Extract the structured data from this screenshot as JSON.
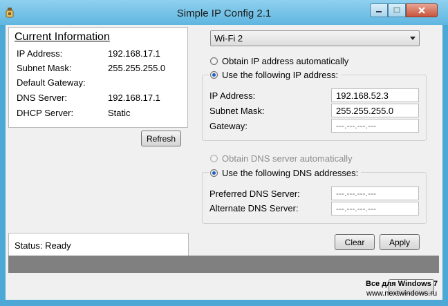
{
  "window": {
    "title": "Simple IP Config 2.1",
    "accent_color": "#4ea8d6",
    "icons": [
      "app-icon",
      "minimize-icon",
      "maximize-icon",
      "close-icon"
    ]
  },
  "current_info": {
    "heading": "Current Information",
    "rows": [
      {
        "label": "IP Address:",
        "value": "192.168.17.1"
      },
      {
        "label": "Subnet Mask:",
        "value": "255.255.255.0"
      },
      {
        "label": "Default Gateway:",
        "value": ""
      },
      {
        "label": "DNS Server:",
        "value": "192.168.17.1"
      },
      {
        "label": "DHCP Server:",
        "value": "Static"
      }
    ],
    "refresh_label": "Refresh"
  },
  "status": {
    "text": "Status: Ready",
    "bar_color": "#808080"
  },
  "adapter": {
    "selected": "Wi-Fi 2"
  },
  "ip_settings": {
    "auto_label": "Obtain IP address automatically",
    "manual_label": "Use the following IP address:",
    "mode": "manual",
    "fields": [
      {
        "label": "IP Address:",
        "value": "192.168.52.3"
      },
      {
        "label": "Subnet Mask:",
        "value": "255.255.255.0"
      },
      {
        "label": "Gateway:",
        "value": "---.---.---.---"
      }
    ]
  },
  "dns_settings": {
    "auto_label": "Obtain DNS server automatically",
    "manual_label": "Use the following DNS addresses:",
    "mode": "manual",
    "fields": [
      {
        "label": "Preferred DNS Server:",
        "value": "---.---.---.---"
      },
      {
        "label": "Alternate DNS Server:",
        "value": "---.---.---.---"
      }
    ]
  },
  "actions": {
    "clear_label": "Clear",
    "apply_label": "Apply"
  },
  "watermark": {
    "line1": "Все для Windows 7",
    "line2": "www.nextwindows.ru"
  }
}
